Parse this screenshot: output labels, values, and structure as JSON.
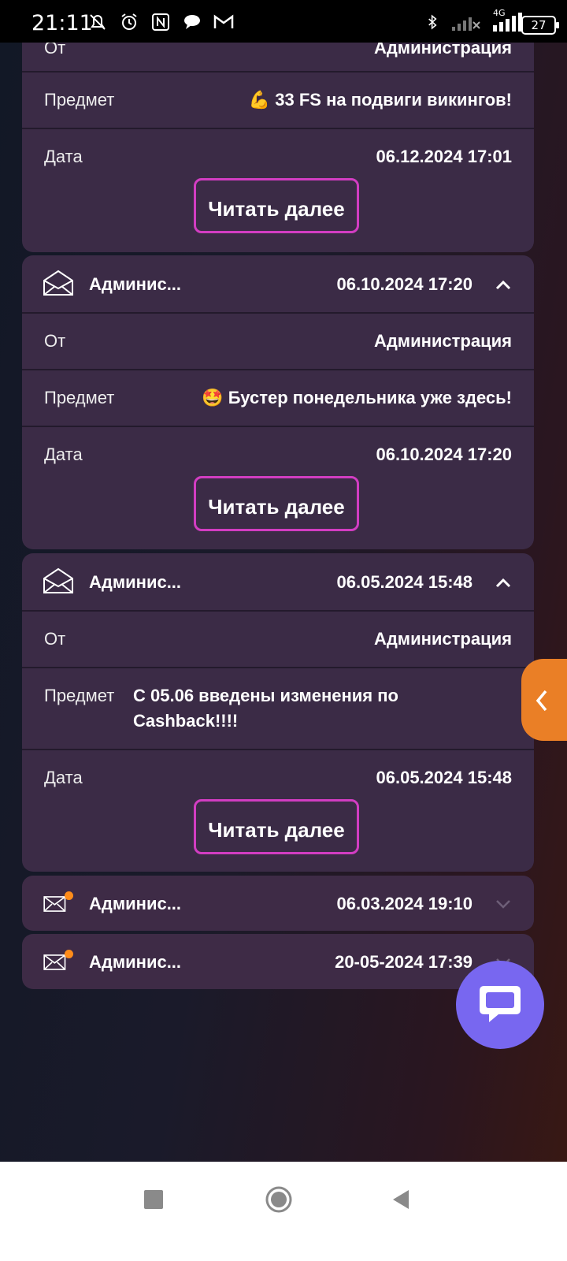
{
  "status_bar": {
    "time": "21:11",
    "network": "4G",
    "battery": "27"
  },
  "messages": [
    {
      "state": "expanded",
      "from_label": "От",
      "from_value": "Администрация",
      "subject_label": "Предмет",
      "subject_value": "💪 33 FS на подвиги викингов!",
      "date_label": "Дата",
      "date_value": "06.12.2024 17:01",
      "read_more": "Читать далее"
    },
    {
      "state": "expanded",
      "sender": "Админис...",
      "header_date": "06.10.2024 17:20",
      "from_label": "От",
      "from_value": "Администрация",
      "subject_label": "Предмет",
      "subject_value": "🤩 Бустер понедельника уже здесь!",
      "date_label": "Дата",
      "date_value": "06.10.2024 17:20",
      "read_more": "Читать далее"
    },
    {
      "state": "expanded",
      "sender": "Админис...",
      "header_date": "06.05.2024 15:48",
      "from_label": "От",
      "from_value": "Администрация",
      "subject_label": "Предмет",
      "subject_value_line1": "С 05.06 введены изменения по",
      "subject_value_line2": "Cashback!!!!",
      "date_label": "Дата",
      "date_value": "06.05.2024 15:48",
      "read_more": "Читать далее"
    },
    {
      "state": "collapsed",
      "unread": true,
      "sender": "Админис...",
      "header_date": "06.03.2024 19:10"
    },
    {
      "state": "collapsed",
      "unread": true,
      "sender": "Админис...",
      "header_date": "20-05-2024 17:39"
    }
  ],
  "icons": {
    "envelope": "envelope-icon",
    "chevron_up": "chevron-up-icon",
    "chevron_down": "chevron-down-icon",
    "side_tab": "chevron-left-icon",
    "chat": "chat-bubble-icon"
  },
  "colors": {
    "card": "#3b2b46",
    "button_border": "#d23dc2",
    "unread_dot": "#ff8c1a",
    "side_tab": "#ea7f26",
    "chat_button": "#7867f0"
  }
}
